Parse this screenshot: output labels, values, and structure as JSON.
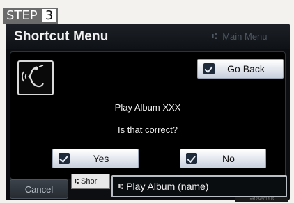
{
  "step": {
    "word": "STEP",
    "number": "3"
  },
  "header": {
    "title": "Shortcut Menu",
    "main_menu_label": "Main Menu"
  },
  "dialog": {
    "go_back_label": "Go Back",
    "prompt": "Play Album XXX",
    "question": "Is that correct?",
    "yes_label": "Yes",
    "no_label": "No"
  },
  "footer": {
    "cancel_label": "Cancel",
    "shortcut_tab_label": "Shor",
    "command_text": "Play Album (name)"
  },
  "watermark": "ntt12345012US",
  "icons": {
    "voice": "voice-recognition-icon",
    "shortcut": "shortcut-icon",
    "check": "checkmark-icon"
  },
  "colors": {
    "screen_bg": "#0c0e12",
    "button_light": "#dfe6f0",
    "title_text": "#f2f2f2"
  }
}
